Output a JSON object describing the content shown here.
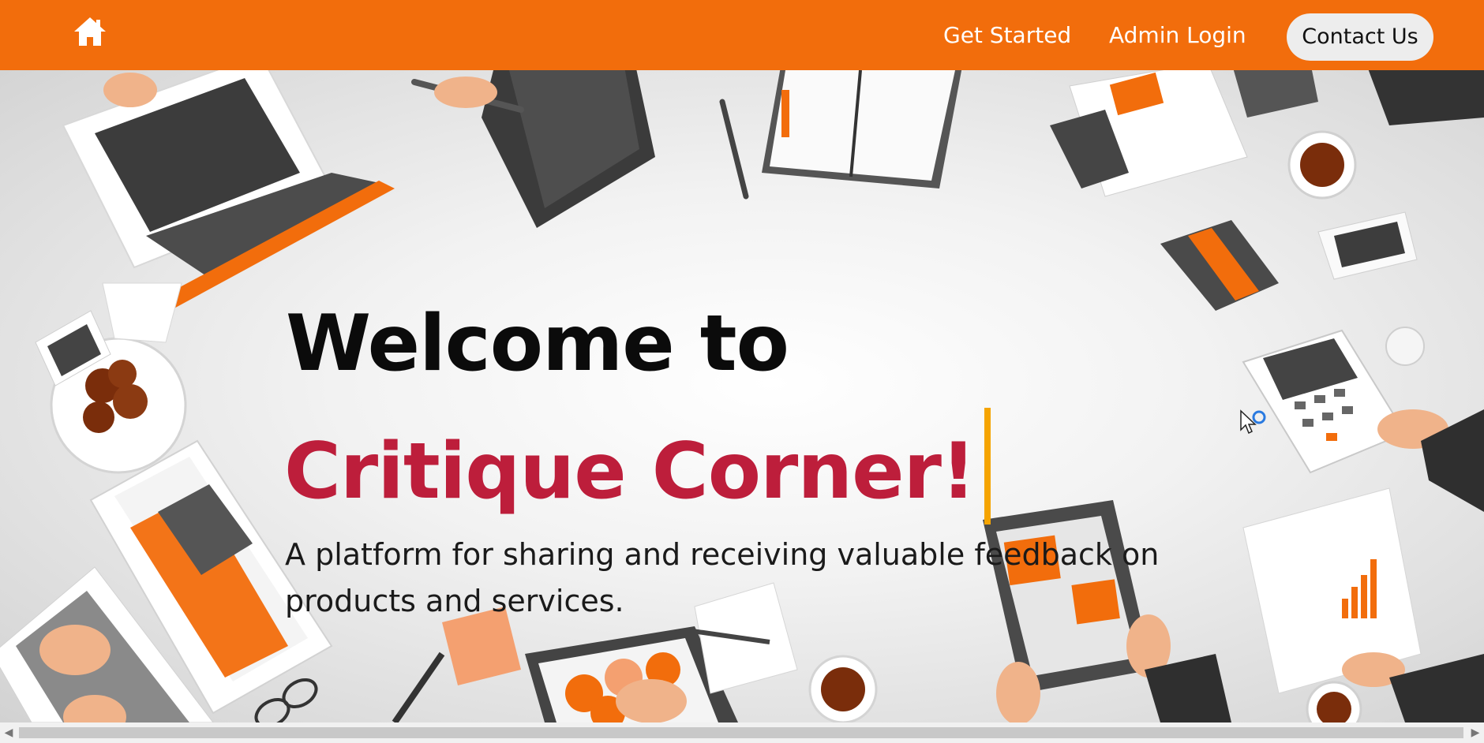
{
  "navbar": {
    "home_icon": "home-icon",
    "links": [
      "Get Started",
      "Admin Login"
    ],
    "contact_label": "Contact Us",
    "background": "#f26d0c"
  },
  "hero": {
    "title_line1": "Welcome to",
    "title_line2": "Critique Corner!",
    "subtitle": "A platform for sharing and receiving valuable feedback on products and services.",
    "title_color": "#0b0b0b",
    "accent_color": "#bd1e3b",
    "caret_color": "#f5a400"
  },
  "scrollbar": {
    "left_arrow": "◀",
    "right_arrow": "▶"
  }
}
